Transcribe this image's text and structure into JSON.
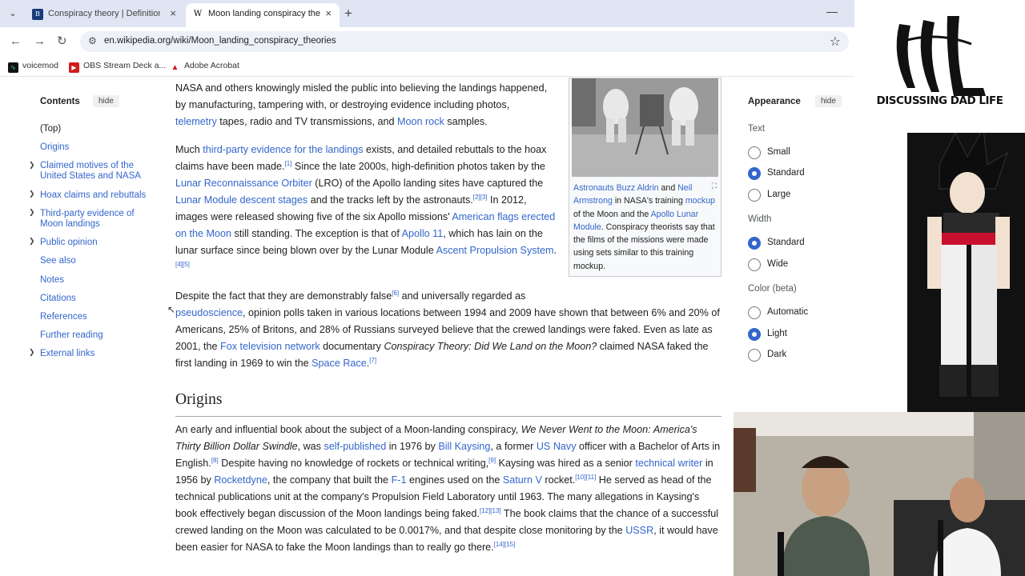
{
  "browser": {
    "tabs": [
      {
        "title": "Conspiracy theory | Definition, E",
        "active": false,
        "favicon": "britannica-icon"
      },
      {
        "title": "Moon landing conspiracy theor",
        "active": true,
        "favicon": "wikipedia-icon"
      }
    ],
    "url": "en.wikipedia.org/wiki/Moon_landing_conspiracy_theories",
    "bookmarks": [
      "voicemod",
      "OBS Stream Deck a...",
      "Adobe Acrobat"
    ]
  },
  "toc": {
    "title": "Contents",
    "hide_label": "hide",
    "items": [
      {
        "label": "(Top)",
        "expandable": false,
        "active": true
      },
      {
        "label": "Origins",
        "expandable": false
      },
      {
        "label": "Claimed motives of the United States and NASA",
        "expandable": true
      },
      {
        "label": "Hoax claims and rebuttals",
        "expandable": true
      },
      {
        "label": "Third-party evidence of Moon landings",
        "expandable": true
      },
      {
        "label": "Public opinion",
        "expandable": true
      },
      {
        "label": "See also",
        "expandable": false
      },
      {
        "label": "Notes",
        "expandable": false
      },
      {
        "label": "Citations",
        "expandable": false
      },
      {
        "label": "References",
        "expandable": false
      },
      {
        "label": "Further reading",
        "expandable": false
      },
      {
        "label": "External links",
        "expandable": true
      }
    ]
  },
  "infobox": {
    "caption_link1": "Astronauts Buzz Aldrin",
    "caption_t1": " and ",
    "caption_link2": "Neil Armstrong",
    "caption_t2": " in NASA's training ",
    "caption_link3": "mockup",
    "caption_t3": " of the Moon and the ",
    "caption_link4": "Apollo Lunar Module",
    "caption_t4": ". Conspiracy theorists say that the films of the missions were made using sets similar to this training mockup."
  },
  "article": {
    "p1": {
      "t1": "NASA and others knowingly misled the public into believing the landings happened, by manufacturing, tampering with, or destroying evidence including photos, ",
      "l1": "telemetry",
      "t2": " tapes, radio and TV transmissions, and ",
      "l2": "Moon rock",
      "t3": " samples."
    },
    "p2": {
      "t1": "Much ",
      "l1": "third-party evidence for the landings",
      "t2": " exists, and detailed rebuttals to the hoax claims have been made.",
      "s1": "[1]",
      "t3": " Since the late 2000s, high-definition photos taken by the ",
      "l2": "Lunar Reconnaissance Orbiter",
      "t4": " (LRO) of the Apollo landing sites have captured the ",
      "l3": "Lunar Module descent stages",
      "t5": " and the tracks left by the astronauts.",
      "s2": "[2][3]",
      "t6": " In 2012, images were released showing five of the six Apollo missions' ",
      "l4": "American flags erected on the Moon",
      "t7": " still standing. The exception is that of ",
      "l5": "Apollo 11",
      "t8": ", which has lain on the lunar surface since being blown over by the Lunar Module ",
      "l6": "Ascent Propulsion System",
      "t9": ".",
      "s3": "[4][5]"
    },
    "p3": {
      "t1": "Despite the fact that they are demonstrably false",
      "s1": "[6]",
      "t2": " and universally regarded as ",
      "l1": "pseudoscience",
      "t3": ", opinion polls taken in various locations between 1994 and 2009 have shown that between 6% and 20% of Americans, 25% of Britons, and 28% of Russians surveyed believe that the crewed landings were faked. Even as late as 2001, the ",
      "l2": "Fox television network",
      "t4": " documentary ",
      "i1": "Conspiracy Theory: Did We Land on the Moon?",
      "t5": " claimed NASA faked the first landing in 1969 to win the ",
      "l3": "Space Race",
      "t6": ".",
      "s2": "[7]"
    },
    "origins_heading": "Origins",
    "p4": {
      "t1": "An early and influential book about the subject of a Moon-landing conspiracy, ",
      "i1": "We Never Went to the Moon: America's Thirty Billion Dollar Swindle",
      "t2": ", was ",
      "l1": "self-published",
      "t3": " in 1976 by ",
      "l2": "Bill Kaysing",
      "t4": ", a former ",
      "l3": "US Navy",
      "t5": " officer with a Bachelor of Arts in English.",
      "s1": "[8]",
      "t6": " Despite having no knowledge of rockets or technical writing,",
      "s2": "[9]",
      "t7": " Kaysing was hired as a senior ",
      "l4": "technical writer",
      "t8": " in 1956 by ",
      "l5": "Rocketdyne",
      "t9": ", the company that built the ",
      "l6": "F-1",
      "t10": " engines used on the ",
      "l7": "Saturn V",
      "t11": " rocket.",
      "s3": "[10][11]",
      "t12": " He served as head of the technical publications unit at the company's Propulsion Field Laboratory until 1963. The many allegations in Kaysing's book effectively began discussion of the Moon landings being faked.",
      "s4": "[12][13]",
      "t13": " The book claims that the chance of a successful crewed landing on the Moon was calculated to be 0.0017%, and that despite close monitoring by the ",
      "l8": "USSR",
      "t14": ", it would have been easier for NASA to fake the Moon landings than to really go there.",
      "s5": "[14][15]"
    }
  },
  "appearance": {
    "title": "Appearance",
    "hide_label": "hide",
    "text_label": "Text",
    "text_options": [
      "Small",
      "Standard",
      "Large"
    ],
    "text_selected": 1,
    "width_label": "Width",
    "width_options": [
      "Standard",
      "Wide"
    ],
    "width_selected": 0,
    "color_label": "Color (beta)",
    "color_options": [
      "Automatic",
      "Light",
      "Dark"
    ],
    "color_selected": 1
  },
  "stream_overlay": {
    "logo_text": "DISCUSSING DAD LIFE"
  }
}
